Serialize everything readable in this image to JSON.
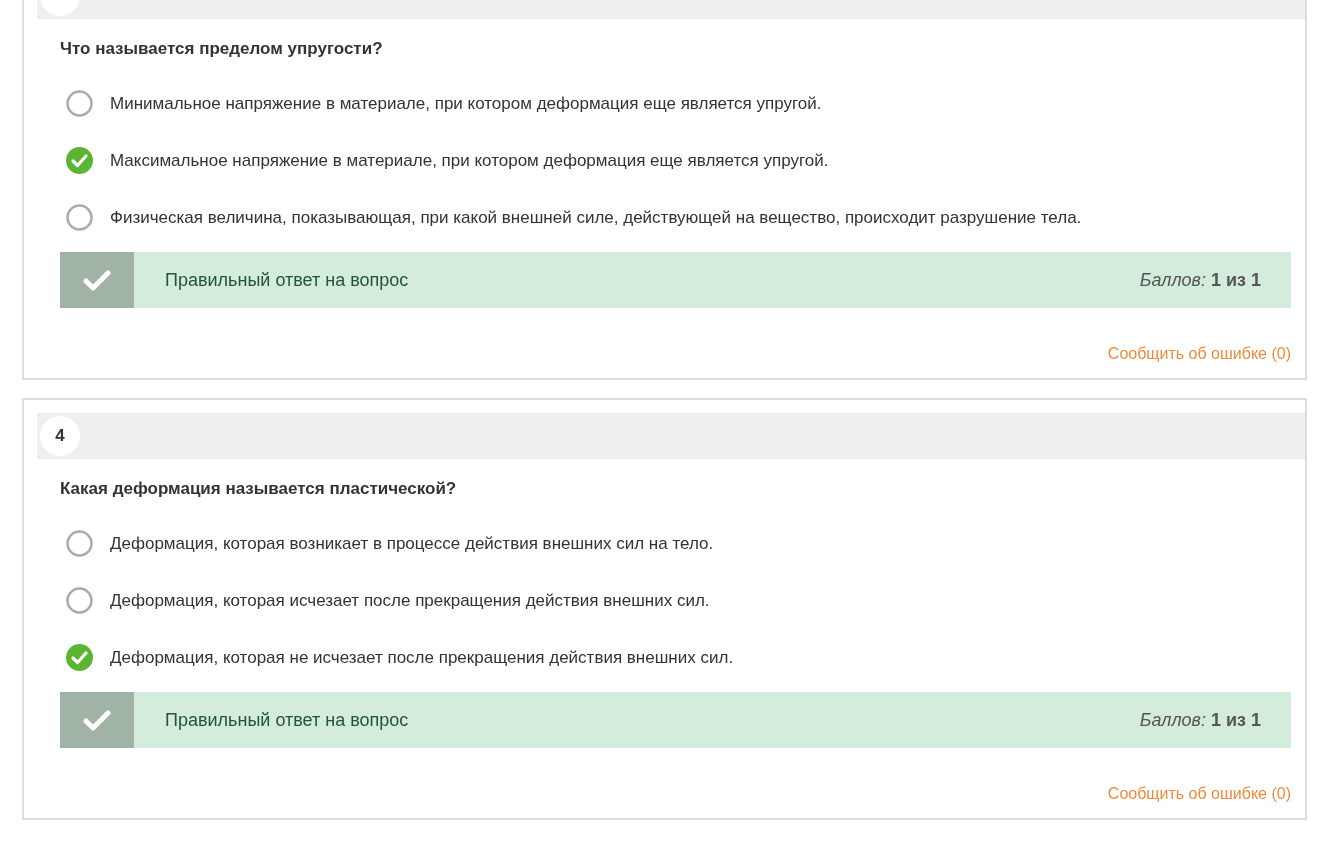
{
  "questions": [
    {
      "title": "Что называется пределом упругости?",
      "options": [
        {
          "text": "Минимальное напряжение в материале, при котором деформация еще является упругой.",
          "selected": false
        },
        {
          "text": "Максимальное напряжение в материале, при котором деформация еще является упругой.",
          "selected": true
        },
        {
          "text": "Физическая величина, показывающая, при какой внешней силе, действующей на вещество, происходит разрушение тела.",
          "selected": false
        }
      ],
      "feedback": {
        "correct": true,
        "text": "Правильный ответ на вопрос",
        "score": "*Баллов:* **1 из 1**"
      },
      "report_link": "Сообщить об ошибке (0)"
    },
    {
      "number": "4",
      "title": "Какая деформация называется пластической?",
      "options": [
        {
          "text": "Деформация, которая возникает в процессе действия внешних сил на тело.",
          "selected": false
        },
        {
          "text": "Деформация, которая исчезает после прекращения действия внешних сил.",
          "selected": false
        },
        {
          "text": "Деформация, которая не исчезает после прекращения действия внешних сил.",
          "selected": true
        }
      ],
      "feedback": {
        "correct": true,
        "text": "Правильный ответ на вопрос",
        "score": "*Баллов:* **1 из 1**"
      },
      "report_link": "Сообщить об ошибке (0)"
    }
  ]
}
